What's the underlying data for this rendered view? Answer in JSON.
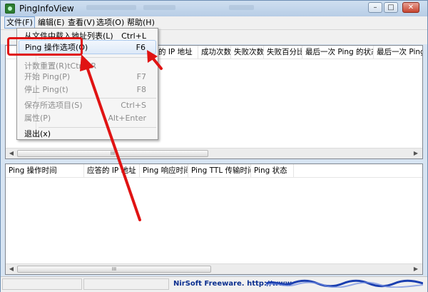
{
  "window": {
    "title": "PingInfoView",
    "buttons": {
      "minimize": "–",
      "maximize": "□",
      "close": "✕"
    }
  },
  "menubar": {
    "items": [
      "文件(F)",
      "编辑(E)",
      "查看(V)",
      "选项(O)",
      "帮助(H)"
    ]
  },
  "top_table": {
    "columns": [
      "的 IP 地址",
      "成功次数",
      "失败次数",
      "失败百分比",
      "最后一次 Ping 的状态",
      "最后一次 Ping 的"
    ],
    "scroll_thumb": "III"
  },
  "bottom_table": {
    "columns": [
      "Ping 操作时间",
      "应答的 IP 地址",
      "Ping 响应时间",
      "Ping TTL 传输时间",
      "Ping 状态"
    ],
    "scroll_thumb": "III"
  },
  "file_menu": {
    "items": [
      {
        "label": "从文件中载入地址列表(L)",
        "shortcut": "Ctrl+L",
        "enabled": true
      },
      {
        "label": "Ping 操作选项(O)",
        "shortcut": "F6",
        "enabled": true,
        "highlighted": true
      },
      {
        "label": "计数重置(R)tCtrl+R",
        "shortcut": "",
        "enabled": false
      },
      {
        "label": "开始 Ping(P)",
        "shortcut": "F7",
        "enabled": false
      },
      {
        "label": "停止 Ping(t)",
        "shortcut": "F8",
        "enabled": false
      },
      {
        "label": "保存所选项目(S)",
        "shortcut": "Ctrl+S",
        "enabled": false
      },
      {
        "label": "属性(P)",
        "shortcut": "Alt+Enter",
        "enabled": false
      },
      {
        "label": "退出(x)",
        "shortcut": "",
        "enabled": true
      }
    ]
  },
  "statusbar": {
    "credit": "NirSoft Freeware.  http://www"
  },
  "colors": {
    "annotation": "#e01313",
    "credit_text": "#0a2f8f"
  }
}
